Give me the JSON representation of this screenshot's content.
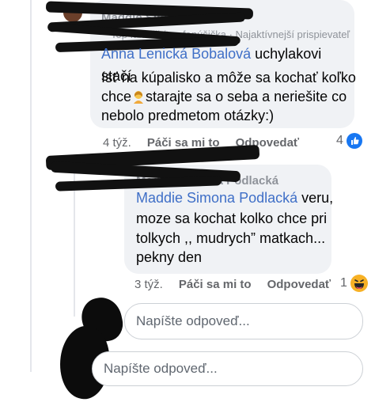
{
  "comments": [
    {
      "author": "Maddie Simona Podlacká",
      "badge": "Top fanúšik/top fanúšička · Najaktívnejší prispievateľ",
      "mention": "Anna Lenická Bobalová",
      "text_line1": "uchylakovi stačí",
      "text_line2": "ísť na kúpalisko a môže sa kochať koľko",
      "text_line3_a": "chce",
      "text_line3_b": "starajte sa o seba a neriešite co",
      "text_line4": "nebolo predmetom  otázky:)",
      "time": "4 týž.",
      "like_label": "Páči sa mi to",
      "reply_label": "Odpovedať",
      "reaction_count": "4"
    },
    {
      "author": "Maddie Simona Podlacká",
      "mention": "Maddie Simona Podlacká",
      "text_line1": "veru,",
      "text_line2": "moze sa kochat kolko chce pri",
      "text_line3": "tolkych ,, mudrych” matkach...",
      "text_line4": "pekny den",
      "time": "3 týž.",
      "like_label": "Páči sa mi to",
      "reply_label": "Odpovedať",
      "reaction_count": "1"
    }
  ],
  "reply_inputs": [
    {
      "placeholder": "Napíšte odpoveď..."
    },
    {
      "placeholder": "Napíšte odpoveď..."
    }
  ],
  "colors": {
    "bubble": "#f0f2f5",
    "link": "#3f6fc7",
    "like_blue": "#1877f2",
    "haha_yellow": "#f7b125"
  },
  "icons": [
    "like-reaction-icon",
    "haha-reaction-icon",
    "woman-gesturing-emoji"
  ]
}
